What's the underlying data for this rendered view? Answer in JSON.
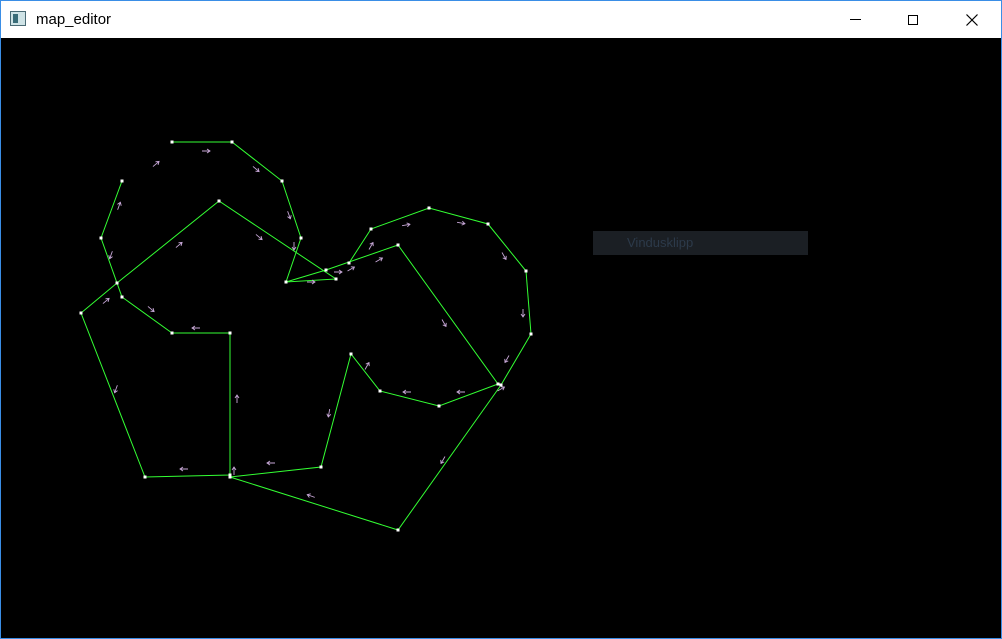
{
  "window": {
    "title": "map_editor",
    "icon": "app-window-icon",
    "controls": [
      "minimize-icon",
      "maximize-icon",
      "close-icon"
    ]
  },
  "canvas": {
    "background": "#000000",
    "edge_color": "#33ff33",
    "vertex_color": "#ffffff",
    "arrow_color": "#c8a8d8"
  },
  "tooltip": {
    "label": "Vindusklipp"
  },
  "arrows": [
    "->",
    "->",
    "->",
    "->",
    "->",
    "->",
    "<-",
    "<-",
    "<-",
    "<-",
    "<-",
    "<-"
  ]
}
